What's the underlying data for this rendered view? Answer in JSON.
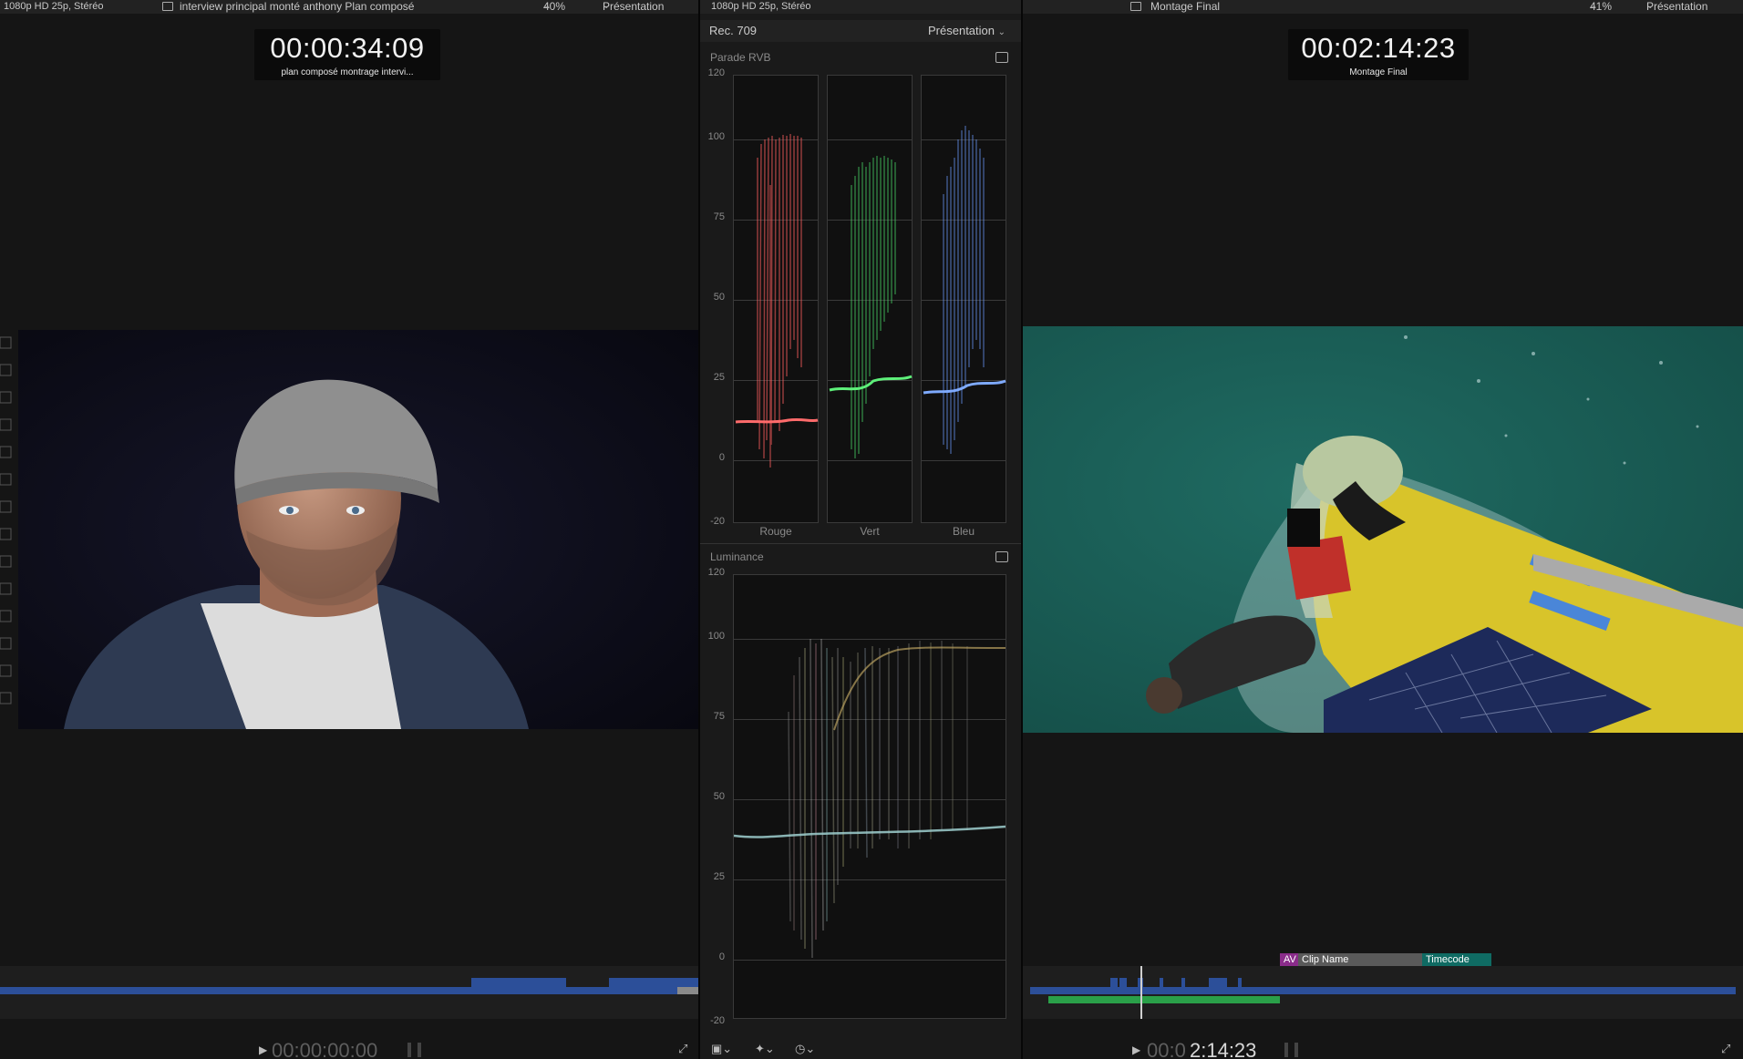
{
  "left_viewer": {
    "format": "1080p HD 25p, Stéréo",
    "clip_title": "interview principal monté anthony Plan composé",
    "zoom": "40%",
    "presentation": "Présentation",
    "timecode": "00:00:34:09",
    "timecode_sub": "plan composé montrage intervi...",
    "playhead_timecode_dim": "00:00:00:00"
  },
  "scopes": {
    "format": "1080p HD 25p, Stéréo",
    "colorspace": "Rec. 709",
    "presentation": "Présentation",
    "rgb_parade": {
      "title": "Parade RVB",
      "axis": [
        "120",
        "100",
        "75",
        "50",
        "25",
        "0",
        "-20"
      ],
      "channels": [
        "Rouge",
        "Vert",
        "Bleu"
      ]
    },
    "luminance": {
      "title": "Luminance",
      "axis": [
        "120",
        "100",
        "75",
        "50",
        "25",
        "0",
        "-20"
      ]
    }
  },
  "right_viewer": {
    "project_title": "Montage Final",
    "zoom": "41%",
    "presentation": "Présentation",
    "timecode": "00:02:14:23",
    "timecode_sub": "Montage Final",
    "overlay_tags": {
      "av": "AV",
      "clip_name": "Clip Name",
      "timecode": "Timecode"
    },
    "playhead_timecode_dim": "00:0",
    "playhead_timecode_bright": "2:14:23"
  },
  "colors": {
    "accent_blue": "#2c4f99",
    "accent_green": "#2aa049",
    "tag_purple": "#8a2c8a",
    "tag_teal": "#0f6b63"
  }
}
